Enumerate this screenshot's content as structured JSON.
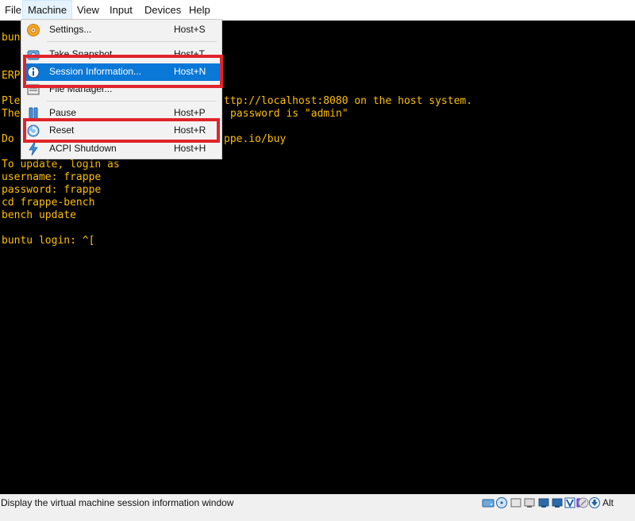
{
  "menubar": {
    "items": [
      {
        "label": "File"
      },
      {
        "label": "Machine"
      },
      {
        "label": "View"
      },
      {
        "label": "Input"
      },
      {
        "label": "Devices"
      },
      {
        "label": "Help"
      }
    ]
  },
  "console": {
    "lines": [
      "bunt",
      "ERPN",
      "Plea",
      "The",
      "Do c",
      "To update, login as",
      "username: frappe",
      "password: frappe",
      "cd frappe-bench",
      "bench update",
      "buntu login: ^[",
      "ttp://localhost:8080 on the host system.",
      "password is \"admin\"",
      "ppe.io/buy"
    ],
    "text_color": "#FFBF00"
  },
  "machine_menu": {
    "items": [
      {
        "label": "Settings...",
        "shortcut": "Host+S",
        "icon": "settings-gear-icon"
      },
      {
        "label": "Take Snapshot...",
        "shortcut": "Host+T",
        "icon": "snapshot-camera-icon"
      },
      {
        "label": "Session Information...",
        "shortcut": "Host+N",
        "icon": "info-icon",
        "highlighted": true
      },
      {
        "label": "File Manager...",
        "shortcut": "",
        "icon": "file-manager-icon"
      },
      {
        "label": "Pause",
        "shortcut": "Host+P",
        "icon": "pause-icon"
      },
      {
        "label": "Reset",
        "shortcut": "Host+R",
        "icon": "reset-icon"
      },
      {
        "label": "ACPI Shutdown",
        "shortcut": "Host+H",
        "icon": "acpi-shutdown-icon"
      }
    ],
    "highlight_color": "#0A78D7",
    "annotation_color": "#E0242B"
  },
  "statusbar": {
    "text": "Display the virtual machine session information window",
    "host_key": "Alt",
    "icons": [
      "hard-disk-icon",
      "optical-drive-icon",
      "audio-icon",
      "network-icon",
      "usb-icon",
      "shared-folders-icon",
      "display-icon",
      "recording-icon",
      "virtualization-icon",
      "mouse-integration-icon",
      "keyboard-capture-icon"
    ]
  }
}
